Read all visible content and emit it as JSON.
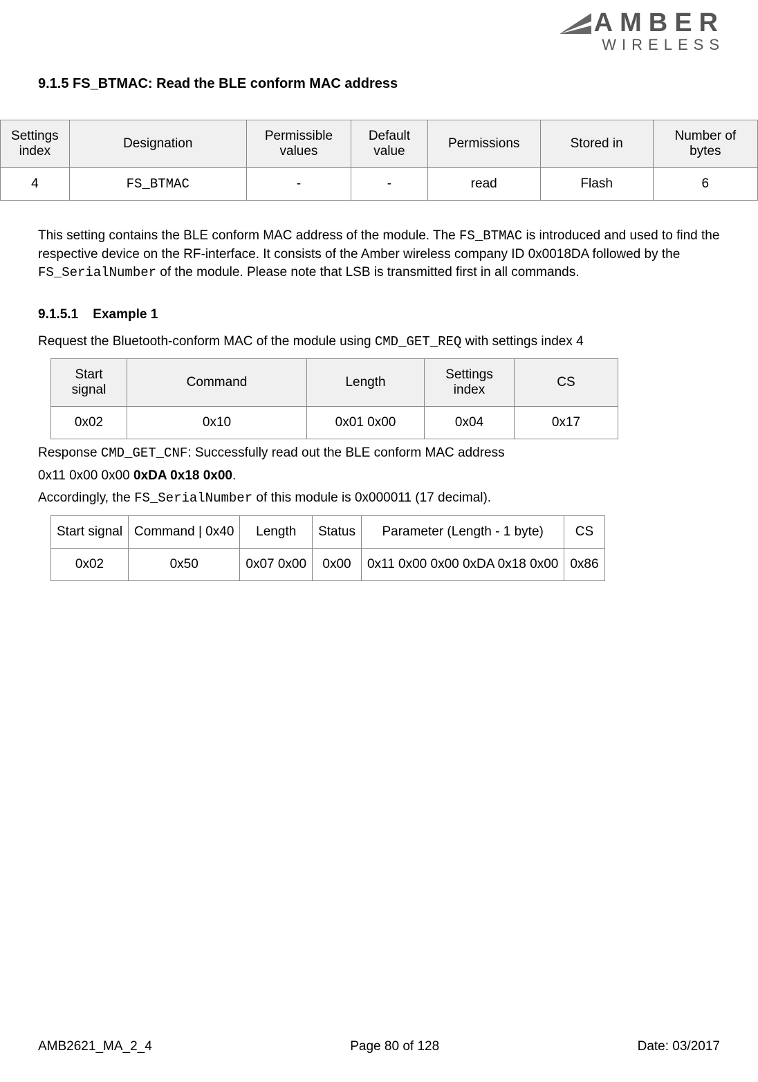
{
  "logo": {
    "line1": "AMBER",
    "line2": "WIRELESS"
  },
  "section": {
    "number": "9.1.5",
    "title": "FS_BTMAC: Read the BLE conform MAC address"
  },
  "settings_table": {
    "headers": [
      "Settings index",
      "Designation",
      "Permissible values",
      "Default value",
      "Permissions",
      "Stored in",
      "Number of bytes"
    ],
    "row": [
      "4",
      "FS_BTMAC",
      "-",
      "-",
      "read",
      "Flash",
      "6"
    ]
  },
  "description": {
    "p1a": "This setting contains the BLE conform MAC address of the module. The ",
    "p1_code1": "FS_BTMAC",
    "p1b": " is introduced and used to find the respective device on the RF-interface. It consists of the Amber wireless company ID 0x0018DA followed by the ",
    "p1_code2": "FS_SerialNumber",
    "p1c": " of the module. Please note that LSB is transmitted first in all commands."
  },
  "example": {
    "number": "9.1.5.1",
    "title": "Example 1",
    "req_text_a": "Request the Bluetooth-conform MAC of the module using  ",
    "req_code": "CMD_GET_REQ",
    "req_text_b": " with settings index 4"
  },
  "req_table": {
    "headers": [
      "Start signal",
      "Command",
      "Length",
      "Settings index",
      "CS"
    ],
    "row": [
      "0x02",
      "0x10",
      "0x01 0x00",
      "0x04",
      "0x17"
    ]
  },
  "response": {
    "p1a": "Response ",
    "p1_code": "CMD_GET_CNF",
    "p1b": ": Successfully read out the BLE conform MAC address",
    "p2a": "0x11 0x00 0x00 ",
    "p2_bold": "0xDA 0x18 0x00",
    "p2b": ".",
    "p3a": "Accordingly, the ",
    "p3_code": "FS_SerialNumber",
    "p3b": " of this module is 0x000011 (17 decimal)."
  },
  "resp_table": {
    "headers": [
      "Start signal",
      "Command | 0x40",
      "Length",
      "Status",
      "Parameter (Length - 1 byte)",
      "CS"
    ],
    "row": [
      "0x02",
      "0x50",
      "0x07 0x00",
      "0x00",
      "0x11 0x00 0x00 0xDA 0x18 0x00",
      "0x86"
    ]
  },
  "footer": {
    "left": "AMB2621_MA_2_4",
    "center": "Page 80 of 128",
    "right": "Date: 03/2017"
  }
}
